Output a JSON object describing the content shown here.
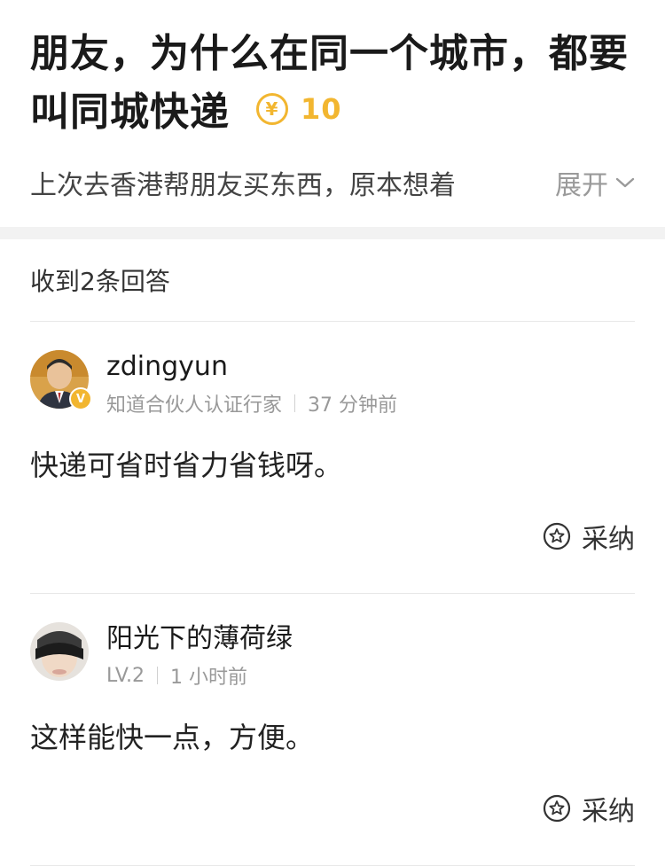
{
  "question": {
    "title": "朋友，为什么在同一个城市，都要叫同城快递",
    "reward_symbol": "¥",
    "reward": "10",
    "description": "上次去香港帮朋友买东西，原本想着",
    "expand_label": "展开"
  },
  "answers_header": "收到2条回答",
  "answers": [
    {
      "username": "zdingyun",
      "badge": "V",
      "title": "知道合伙人认证行家",
      "time": "37 分钟前",
      "text": "快递可省时省力省钱呀。",
      "accept_label": "采纳"
    },
    {
      "username": "阳光下的薄荷绿",
      "level": "LV.2",
      "time": "1 小时前",
      "text": "这样能快一点，方便。",
      "accept_label": "采纳"
    }
  ],
  "colors": {
    "accent": "#f2b630",
    "muted": "#999999",
    "divider": "#f2f2f2"
  }
}
